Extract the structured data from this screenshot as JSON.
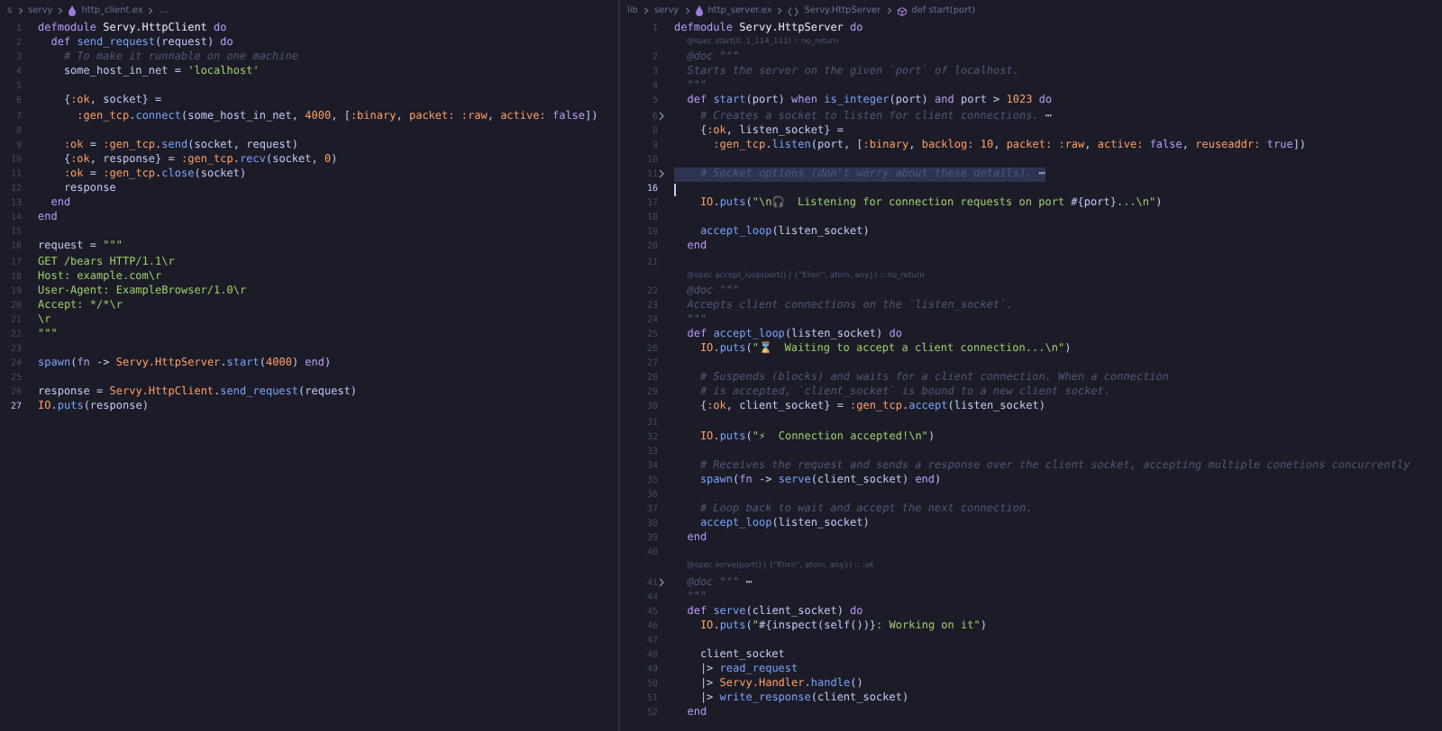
{
  "panes": [
    {
      "breadcrumb": [
        {
          "kind": "folder",
          "text": "s"
        },
        {
          "kind": "folder",
          "text": "servy"
        },
        {
          "kind": "file",
          "text": "http_client.ex"
        },
        {
          "kind": "more",
          "text": "..."
        }
      ],
      "lines": [
        {
          "kind": "code",
          "number": "1",
          "current": false,
          "tokens": [
            {
              "kind": "kw",
              "text": "defmodule "
            },
            {
              "kind": "mod",
              "text": "Servy.HttpClient "
            },
            {
              "kind": "kw",
              "text": "do"
            }
          ]
        },
        {
          "kind": "code",
          "number": "2",
          "current": false,
          "tokens": [
            {
              "kind": "kw",
              "text": "  def "
            },
            {
              "kind": "fn",
              "text": "send_request"
            },
            {
              "kind": "txt",
              "text": "(request) "
            },
            {
              "kind": "kw",
              "text": "do"
            }
          ]
        },
        {
          "kind": "code",
          "number": "3",
          "current": false,
          "tokens": [
            {
              "kind": "com",
              "text": "    # To make it runnable on one machine"
            }
          ]
        },
        {
          "kind": "code",
          "number": "4",
          "current": false,
          "tokens": [
            {
              "kind": "txt",
              "text": "    some_host_in_net = "
            },
            {
              "kind": "str",
              "text": "'localhost'"
            }
          ]
        },
        {
          "kind": "code",
          "number": "5",
          "current": false
        },
        {
          "kind": "code",
          "number": "6",
          "current": false,
          "tokens": [
            {
              "kind": "txt",
              "text": "    {"
            },
            {
              "kind": "atom",
              "text": ":ok"
            },
            {
              "kind": "txt",
              "text": ", socket} ="
            }
          ]
        },
        {
          "kind": "code",
          "number": "7",
          "current": false,
          "tokens": [
            {
              "kind": "atom",
              "text": "      :gen_tcp"
            },
            {
              "kind": "txt",
              "text": "."
            },
            {
              "kind": "fn",
              "text": "connect"
            },
            {
              "kind": "txt",
              "text": "(some_host_in_net, "
            },
            {
              "kind": "num",
              "text": "4000"
            },
            {
              "kind": "txt",
              "text": ", ["
            },
            {
              "kind": "atom",
              "text": ":binary"
            },
            {
              "kind": "txt",
              "text": ", "
            },
            {
              "kind": "atom",
              "text": "packet: :raw"
            },
            {
              "kind": "txt",
              "text": ", "
            },
            {
              "kind": "atom",
              "text": "active: "
            },
            {
              "kind": "kw",
              "text": "false"
            },
            {
              "kind": "txt",
              "text": "])"
            }
          ]
        },
        {
          "kind": "code",
          "number": "8",
          "current": false
        },
        {
          "kind": "code",
          "number": "9",
          "current": false,
          "tokens": [
            {
              "kind": "atom",
              "text": "    :ok"
            },
            {
              "kind": "txt",
              "text": " = "
            },
            {
              "kind": "atom",
              "text": ":gen_tcp"
            },
            {
              "kind": "txt",
              "text": "."
            },
            {
              "kind": "fn",
              "text": "send"
            },
            {
              "kind": "txt",
              "text": "(socket, request)"
            }
          ]
        },
        {
          "kind": "code",
          "number": "10",
          "current": false,
          "tokens": [
            {
              "kind": "txt",
              "text": "    {"
            },
            {
              "kind": "atom",
              "text": ":ok"
            },
            {
              "kind": "txt",
              "text": ", response} = "
            },
            {
              "kind": "atom",
              "text": ":gen_tcp"
            },
            {
              "kind": "txt",
              "text": "."
            },
            {
              "kind": "fn",
              "text": "recv"
            },
            {
              "kind": "txt",
              "text": "(socket, "
            },
            {
              "kind": "num",
              "text": "0"
            },
            {
              "kind": "txt",
              "text": ")"
            }
          ]
        },
        {
          "kind": "code",
          "number": "11",
          "current": false,
          "tokens": [
            {
              "kind": "atom",
              "text": "    :ok"
            },
            {
              "kind": "txt",
              "text": " = "
            },
            {
              "kind": "atom",
              "text": ":gen_tcp"
            },
            {
              "kind": "txt",
              "text": "."
            },
            {
              "kind": "fn",
              "text": "close"
            },
            {
              "kind": "txt",
              "text": "(socket)"
            }
          ]
        },
        {
          "kind": "code",
          "number": "12",
          "current": false,
          "tokens": [
            {
              "kind": "txt",
              "text": "    response"
            }
          ]
        },
        {
          "kind": "code",
          "number": "13",
          "current": false,
          "tokens": [
            {
              "kind": "kw",
              "text": "  end"
            }
          ]
        },
        {
          "kind": "code",
          "number": "14",
          "current": false,
          "tokens": [
            {
              "kind": "kw",
              "text": "end"
            }
          ]
        },
        {
          "kind": "code",
          "number": "15",
          "current": false
        },
        {
          "kind": "code",
          "number": "16",
          "current": false,
          "tokens": [
            {
              "kind": "txt",
              "text": "request = "
            },
            {
              "kind": "str",
              "text": "\"\"\""
            }
          ]
        },
        {
          "kind": "code",
          "number": "17",
          "current": false,
          "tokens": [
            {
              "kind": "str",
              "text": "GET /bears HTTP/1.1\\r"
            }
          ]
        },
        {
          "kind": "code",
          "number": "18",
          "current": false,
          "tokens": [
            {
              "kind": "str",
              "text": "Host: example.com\\r"
            }
          ]
        },
        {
          "kind": "code",
          "number": "19",
          "current": false,
          "tokens": [
            {
              "kind": "str",
              "text": "User-Agent: ExampleBrowser/1.0\\r"
            }
          ]
        },
        {
          "kind": "code",
          "number": "20",
          "current": false,
          "tokens": [
            {
              "kind": "str",
              "text": "Accept: */*\\r"
            }
          ]
        },
        {
          "kind": "code",
          "number": "21",
          "current": false,
          "tokens": [
            {
              "kind": "str",
              "text": "\\r"
            }
          ]
        },
        {
          "kind": "code",
          "number": "22",
          "current": false,
          "tokens": [
            {
              "kind": "str",
              "text": "\"\"\""
            }
          ]
        },
        {
          "kind": "code",
          "number": "23",
          "current": false
        },
        {
          "kind": "code",
          "number": "24",
          "current": false,
          "tokens": [
            {
              "kind": "fn",
              "text": "spawn"
            },
            {
              "kind": "txt",
              "text": "("
            },
            {
              "kind": "kw",
              "text": "fn"
            },
            {
              "kind": "txt",
              "text": " -> "
            },
            {
              "kind": "cls",
              "text": "Servy.HttpServer"
            },
            {
              "kind": "txt",
              "text": "."
            },
            {
              "kind": "fn",
              "text": "start"
            },
            {
              "kind": "txt",
              "text": "("
            },
            {
              "kind": "num",
              "text": "4000"
            },
            {
              "kind": "txt",
              "text": ") "
            },
            {
              "kind": "kw",
              "text": "end"
            },
            {
              "kind": "txt",
              "text": ")"
            }
          ]
        },
        {
          "kind": "code",
          "number": "25",
          "current": false
        },
        {
          "kind": "code",
          "number": "26",
          "current": false,
          "tokens": [
            {
              "kind": "txt",
              "text": "response = "
            },
            {
              "kind": "cls",
              "text": "Servy.HttpClient"
            },
            {
              "kind": "txt",
              "text": "."
            },
            {
              "kind": "fn",
              "text": "send_request"
            },
            {
              "kind": "txt",
              "text": "(request)"
            }
          ]
        },
        {
          "kind": "code",
          "number": "27",
          "current": true,
          "tokens": [
            {
              "kind": "cls",
              "text": "IO"
            },
            {
              "kind": "txt",
              "text": "."
            },
            {
              "kind": "fn",
              "text": "puts"
            },
            {
              "kind": "txt",
              "text": "(response)"
            }
          ]
        }
      ]
    },
    {
      "breadcrumb": [
        {
          "kind": "folder",
          "text": "lib"
        },
        {
          "kind": "folder",
          "text": "servy"
        },
        {
          "kind": "file",
          "text": "http_server.ex"
        },
        {
          "kind": "module",
          "text": "Servy.HttpServer"
        },
        {
          "kind": "function",
          "text": "def start(port)"
        }
      ],
      "lines": [
        {
          "kind": "code",
          "number": "1",
          "current": false,
          "folded": false,
          "selected": false,
          "tokens": [
            {
              "kind": "kw",
              "text": "defmodule "
            },
            {
              "kind": "mod",
              "text": "Servy.HttpServer "
            },
            {
              "kind": "kw",
              "text": "do"
            }
          ]
        },
        {
          "kind": "lens",
          "text": "@spec start(0..1_114_111) :: no_return"
        },
        {
          "kind": "code",
          "number": "2",
          "current": false,
          "folded": false,
          "selected": false,
          "tokens": [
            {
              "kind": "com",
              "text": "  @doc \"\"\""
            }
          ]
        },
        {
          "kind": "code",
          "number": "3",
          "current": false,
          "folded": false,
          "selected": false,
          "tokens": [
            {
              "kind": "com",
              "text": "  Starts the server on the given `port` of localhost."
            }
          ]
        },
        {
          "kind": "code",
          "number": "4",
          "current": false,
          "folded": false,
          "selected": false,
          "tokens": [
            {
              "kind": "com",
              "text": "  \"\"\""
            }
          ]
        },
        {
          "kind": "code",
          "number": "5",
          "current": false,
          "folded": false,
          "selected": false,
          "tokens": [
            {
              "kind": "kw",
              "text": "  def "
            },
            {
              "kind": "fn",
              "text": "start"
            },
            {
              "kind": "txt",
              "text": "(port) "
            },
            {
              "kind": "kw",
              "text": "when "
            },
            {
              "kind": "fn",
              "text": "is_integer"
            },
            {
              "kind": "txt",
              "text": "(port) "
            },
            {
              "kind": "kw",
              "text": "and "
            },
            {
              "kind": "txt",
              "text": "port > "
            },
            {
              "kind": "num",
              "text": "1023"
            },
            {
              "kind": "kw",
              "text": " do"
            }
          ]
        },
        {
          "kind": "code",
          "number": "6",
          "current": false,
          "folded": true,
          "selected": false,
          "tokens": [
            {
              "kind": "com",
              "text": "    # Creates a socket to listen for client connections."
            },
            {
              "kind": "txt",
              "text": " ⋯"
            }
          ]
        },
        {
          "kind": "code",
          "number": "8",
          "current": false,
          "folded": false,
          "selected": false,
          "tokens": [
            {
              "kind": "txt",
              "text": "    {"
            },
            {
              "kind": "atom",
              "text": ":ok"
            },
            {
              "kind": "txt",
              "text": ", listen_socket} ="
            }
          ]
        },
        {
          "kind": "code",
          "number": "9",
          "current": false,
          "folded": false,
          "selected": false,
          "tokens": [
            {
              "kind": "atom",
              "text": "      :gen_tcp"
            },
            {
              "kind": "txt",
              "text": "."
            },
            {
              "kind": "fn",
              "text": "listen"
            },
            {
              "kind": "txt",
              "text": "(port, ["
            },
            {
              "kind": "atom",
              "text": ":binary"
            },
            {
              "kind": "txt",
              "text": ", "
            },
            {
              "kind": "atom",
              "text": "backlog: "
            },
            {
              "kind": "num",
              "text": "10"
            },
            {
              "kind": "txt",
              "text": ", "
            },
            {
              "kind": "atom",
              "text": "packet: :raw"
            },
            {
              "kind": "txt",
              "text": ", "
            },
            {
              "kind": "atom",
              "text": "active: "
            },
            {
              "kind": "kw",
              "text": "false"
            },
            {
              "kind": "txt",
              "text": ", "
            },
            {
              "kind": "atom",
              "text": "reuseaddr: "
            },
            {
              "kind": "kw",
              "text": "true"
            },
            {
              "kind": "txt",
              "text": "])"
            }
          ]
        },
        {
          "kind": "code",
          "number": "10",
          "current": false,
          "folded": false,
          "selected": false
        },
        {
          "kind": "code",
          "number": "11",
          "current": false,
          "folded": true,
          "selected": true,
          "tokens": [
            {
              "kind": "com",
              "text": "    # Socket options (don't worry about these details)."
            },
            {
              "kind": "txt",
              "text": " ⋯"
            }
          ]
        },
        {
          "kind": "code",
          "number": "16",
          "current": true,
          "folded": false,
          "selected": false
        },
        {
          "kind": "code",
          "number": "17",
          "current": false,
          "folded": false,
          "selected": false,
          "tokens": [
            {
              "kind": "cls",
              "text": "    IO"
            },
            {
              "kind": "txt",
              "text": "."
            },
            {
              "kind": "fn",
              "text": "puts"
            },
            {
              "kind": "txt",
              "text": "("
            },
            {
              "kind": "str",
              "text": "\"\\n🎧  Listening for connection requests on port "
            },
            {
              "kind": "txt",
              "text": "#{port}"
            },
            {
              "kind": "str",
              "text": "...\\n\""
            },
            {
              "kind": "txt",
              "text": ")"
            }
          ]
        },
        {
          "kind": "code",
          "number": "18",
          "current": false,
          "folded": false,
          "selected": false
        },
        {
          "kind": "code",
          "number": "19",
          "current": false,
          "folded": false,
          "selected": false,
          "tokens": [
            {
              "kind": "fn",
              "text": "    accept_loop"
            },
            {
              "kind": "txt",
              "text": "(listen_socket)"
            }
          ]
        },
        {
          "kind": "code",
          "number": "20",
          "current": false,
          "folded": false,
          "selected": false,
          "tokens": [
            {
              "kind": "kw",
              "text": "  end"
            }
          ]
        },
        {
          "kind": "code",
          "number": "21",
          "current": false,
          "folded": false,
          "selected": false
        },
        {
          "kind": "lens",
          "text": "@spec accept_loop(port() | {\"Elixir\", atom, any}) :: no_return"
        },
        {
          "kind": "code",
          "number": "22",
          "current": false,
          "folded": false,
          "selected": false,
          "tokens": [
            {
              "kind": "com",
              "text": "  @doc \"\"\""
            }
          ]
        },
        {
          "kind": "code",
          "number": "23",
          "current": false,
          "folded": false,
          "selected": false,
          "tokens": [
            {
              "kind": "com",
              "text": "  Accepts client connections on the `listen_socket`."
            }
          ]
        },
        {
          "kind": "code",
          "number": "24",
          "current": false,
          "folded": false,
          "selected": false,
          "tokens": [
            {
              "kind": "com",
              "text": "  \"\"\""
            }
          ]
        },
        {
          "kind": "code",
          "number": "25",
          "current": false,
          "folded": false,
          "selected": false,
          "tokens": [
            {
              "kind": "kw",
              "text": "  def "
            },
            {
              "kind": "fn",
              "text": "accept_loop"
            },
            {
              "kind": "txt",
              "text": "(listen_socket) "
            },
            {
              "kind": "kw",
              "text": "do"
            }
          ]
        },
        {
          "kind": "code",
          "number": "26",
          "current": false,
          "folded": false,
          "selected": false,
          "tokens": [
            {
              "kind": "cls",
              "text": "    IO"
            },
            {
              "kind": "txt",
              "text": "."
            },
            {
              "kind": "fn",
              "text": "puts"
            },
            {
              "kind": "txt",
              "text": "("
            },
            {
              "kind": "str",
              "text": "\"⌛  Waiting to accept a client connection...\\n\""
            },
            {
              "kind": "txt",
              "text": ")"
            }
          ]
        },
        {
          "kind": "code",
          "number": "27",
          "current": false,
          "folded": false,
          "selected": false
        },
        {
          "kind": "code",
          "number": "28",
          "current": false,
          "folded": false,
          "selected": false,
          "tokens": [
            {
              "kind": "com",
              "text": "    # Suspends (blocks) and waits for a client connection. When a connection"
            }
          ]
        },
        {
          "kind": "code",
          "number": "29",
          "current": false,
          "folded": false,
          "selected": false,
          "tokens": [
            {
              "kind": "com",
              "text": "    # is accepted, `client_socket` is bound to a new client socket."
            }
          ]
        },
        {
          "kind": "code",
          "number": "30",
          "current": false,
          "folded": false,
          "selected": false,
          "tokens": [
            {
              "kind": "txt",
              "text": "    {"
            },
            {
              "kind": "atom",
              "text": ":ok"
            },
            {
              "kind": "txt",
              "text": ", client_socket} = "
            },
            {
              "kind": "atom",
              "text": ":gen_tcp"
            },
            {
              "kind": "txt",
              "text": "."
            },
            {
              "kind": "fn",
              "text": "accept"
            },
            {
              "kind": "txt",
              "text": "(listen_socket)"
            }
          ]
        },
        {
          "kind": "code",
          "number": "31",
          "current": false,
          "folded": false,
          "selected": false
        },
        {
          "kind": "code",
          "number": "32",
          "current": false,
          "folded": false,
          "selected": false,
          "tokens": [
            {
              "kind": "cls",
              "text": "    IO"
            },
            {
              "kind": "txt",
              "text": "."
            },
            {
              "kind": "fn",
              "text": "puts"
            },
            {
              "kind": "txt",
              "text": "("
            },
            {
              "kind": "str",
              "text": "\"⚡  Connection accepted!\\n\""
            },
            {
              "kind": "txt",
              "text": ")"
            }
          ]
        },
        {
          "kind": "code",
          "number": "33",
          "current": false,
          "folded": false,
          "selected": false
        },
        {
          "kind": "code",
          "number": "34",
          "current": false,
          "folded": false,
          "selected": false,
          "tokens": [
            {
              "kind": "com",
              "text": "    # Receives the request and sends a response over the client socket, accepting multiple conetions concurrently"
            }
          ]
        },
        {
          "kind": "code",
          "number": "35",
          "current": false,
          "folded": false,
          "selected": false,
          "tokens": [
            {
              "kind": "fn",
              "text": "    spawn"
            },
            {
              "kind": "txt",
              "text": "("
            },
            {
              "kind": "kw",
              "text": "fn"
            },
            {
              "kind": "txt",
              "text": " -> "
            },
            {
              "kind": "fn",
              "text": "serve"
            },
            {
              "kind": "txt",
              "text": "(client_socket) "
            },
            {
              "kind": "kw",
              "text": "end"
            },
            {
              "kind": "txt",
              "text": ")"
            }
          ]
        },
        {
          "kind": "code",
          "number": "36",
          "current": false,
          "folded": false,
          "selected": false
        },
        {
          "kind": "code",
          "number": "37",
          "current": false,
          "folded": false,
          "selected": false,
          "tokens": [
            {
              "kind": "com",
              "text": "    # Loop back to wait and accept the next connection."
            }
          ]
        },
        {
          "kind": "code",
          "number": "38",
          "current": false,
          "folded": false,
          "selected": false,
          "tokens": [
            {
              "kind": "fn",
              "text": "    accept_loop"
            },
            {
              "kind": "txt",
              "text": "(listen_socket)"
            }
          ]
        },
        {
          "kind": "code",
          "number": "39",
          "current": false,
          "folded": false,
          "selected": false,
          "tokens": [
            {
              "kind": "kw",
              "text": "  end"
            }
          ]
        },
        {
          "kind": "code",
          "number": "40",
          "current": false,
          "folded": false,
          "selected": false
        },
        {
          "kind": "lens",
          "text": "@spec serve(port() | {\"Elixir\", atom, any}) :: :ok"
        },
        {
          "kind": "code",
          "number": "41",
          "current": false,
          "folded": true,
          "selected": false,
          "tokens": [
            {
              "kind": "com",
              "text": "  @doc \"\"\""
            },
            {
              "kind": "txt",
              "text": " ⋯"
            }
          ]
        },
        {
          "kind": "code",
          "number": "44",
          "current": false,
          "folded": false,
          "selected": false,
          "tokens": [
            {
              "kind": "com",
              "text": "  \"\"\""
            }
          ]
        },
        {
          "kind": "code",
          "number": "45",
          "current": false,
          "folded": false,
          "selected": false,
          "tokens": [
            {
              "kind": "kw",
              "text": "  def "
            },
            {
              "kind": "fn",
              "text": "serve"
            },
            {
              "kind": "txt",
              "text": "(client_socket) "
            },
            {
              "kind": "kw",
              "text": "do"
            }
          ]
        },
        {
          "kind": "code",
          "number": "46",
          "current": false,
          "folded": false,
          "selected": false,
          "tokens": [
            {
              "kind": "cls",
              "text": "    IO"
            },
            {
              "kind": "txt",
              "text": "."
            },
            {
              "kind": "fn",
              "text": "puts"
            },
            {
              "kind": "txt",
              "text": "("
            },
            {
              "kind": "str",
              "text": "\""
            },
            {
              "kind": "txt",
              "text": "#{inspect(self())}"
            },
            {
              "kind": "str",
              "text": ": Working on it\""
            },
            {
              "kind": "txt",
              "text": ")"
            }
          ]
        },
        {
          "kind": "code",
          "number": "47",
          "current": false,
          "folded": false,
          "selected": false
        },
        {
          "kind": "code",
          "number": "48",
          "current": false,
          "folded": false,
          "selected": false,
          "tokens": [
            {
              "kind": "txt",
              "text": "    client_socket"
            }
          ]
        },
        {
          "kind": "code",
          "number": "49",
          "current": false,
          "folded": false,
          "selected": false,
          "tokens": [
            {
              "kind": "txt",
              "text": "    |> "
            },
            {
              "kind": "fn",
              "text": "read_request"
            }
          ]
        },
        {
          "kind": "code",
          "number": "50",
          "current": false,
          "folded": false,
          "selected": false,
          "tokens": [
            {
              "kind": "txt",
              "text": "    |> "
            },
            {
              "kind": "cls",
              "text": "Servy.Handler"
            },
            {
              "kind": "txt",
              "text": "."
            },
            {
              "kind": "fn",
              "text": "handle"
            },
            {
              "kind": "txt",
              "text": "()"
            }
          ]
        },
        {
          "kind": "code",
          "number": "51",
          "current": false,
          "folded": false,
          "selected": false,
          "tokens": [
            {
              "kind": "txt",
              "text": "    |> "
            },
            {
              "kind": "fn",
              "text": "write_response"
            },
            {
              "kind": "txt",
              "text": "(client_socket)"
            }
          ]
        },
        {
          "kind": "code",
          "number": "52",
          "current": false,
          "folded": false,
          "selected": false,
          "tokens": [
            {
              "kind": "kw",
              "text": "  end"
            }
          ]
        }
      ]
    }
  ]
}
